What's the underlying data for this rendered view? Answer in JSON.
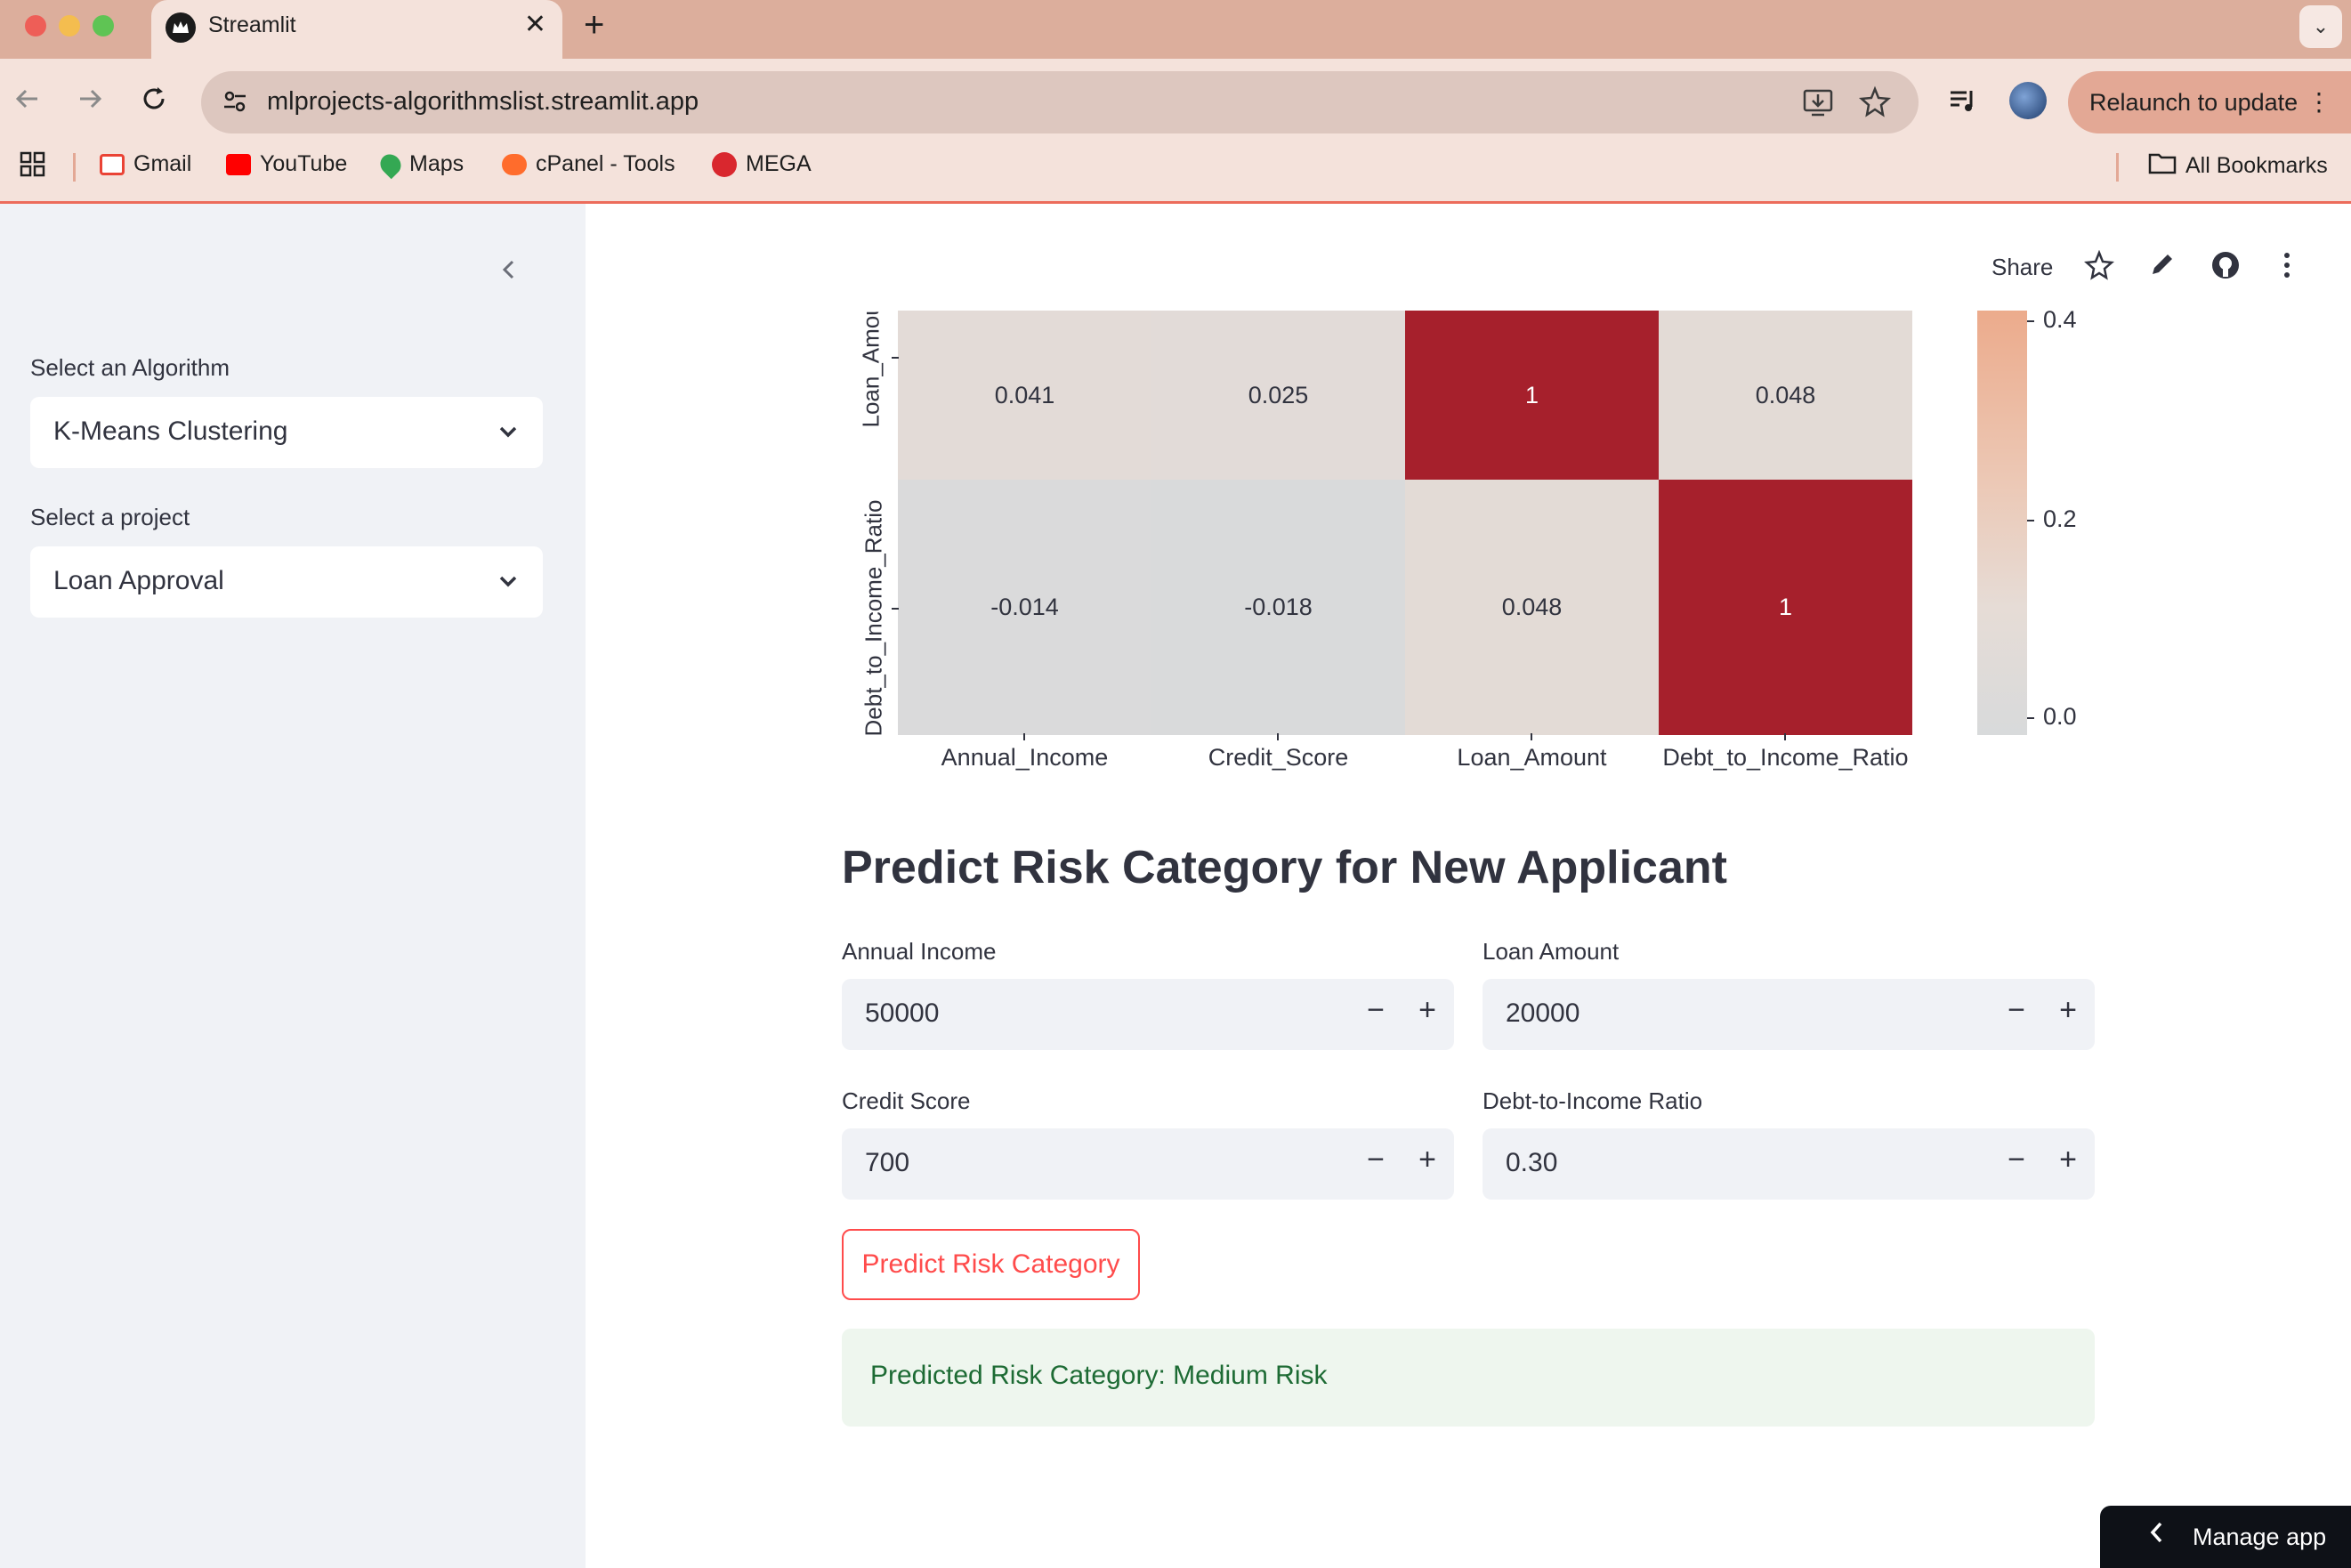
{
  "browser": {
    "tab_title": "Streamlit",
    "tab_close": "✕",
    "new_tab": "+",
    "tab_menu": "⌄",
    "url": "mlprojects-algorithmslist.streamlit.app",
    "relaunch_label": "Relaunch to update",
    "bookmarks": [
      {
        "label": "Gmail",
        "color": "#ea4335"
      },
      {
        "label": "YouTube",
        "color": "#ff0000"
      },
      {
        "label": "Maps",
        "color": "#34a853"
      },
      {
        "label": "cPanel - Tools",
        "color": "#ff6c2c"
      },
      {
        "label": "MEGA",
        "color": "#d9272e"
      }
    ],
    "all_bookmarks": "All Bookmarks"
  },
  "sidebar": {
    "algorithm_label": "Select an Algorithm",
    "algorithm_value": "K-Means Clustering",
    "project_label": "Select a project",
    "project_value": "Loan Approval"
  },
  "header": {
    "share": "Share"
  },
  "chart_data": {
    "type": "heatmap",
    "x_labels": [
      "Annual_Income",
      "Credit_Score",
      "Loan_Amount",
      "Debt_to_Income_Ratio"
    ],
    "y_labels": [
      "Loan_Amount",
      "Debt_to_Income_Ratio"
    ],
    "y_labels_visible": [
      "Loan_Amou",
      "Debt_to_Income_Ratio"
    ],
    "values": [
      [
        "0.041",
        "0.025",
        "1",
        "0.048"
      ],
      [
        "-0.014",
        "-0.018",
        "0.048",
        "1"
      ]
    ],
    "colorbar_ticks": [
      "0.4",
      "0.2",
      "0.0"
    ],
    "colors": {
      "high": "#a6202c",
      "low": "#d8dadb",
      "mid": "#e6dcd6"
    }
  },
  "form": {
    "title": "Predict Risk Category for New Applicant",
    "annual_income_label": "Annual Income",
    "annual_income_value": "50000",
    "loan_amount_label": "Loan Amount",
    "loan_amount_value": "20000",
    "credit_score_label": "Credit Score",
    "credit_score_value": "700",
    "dti_label": "Debt-to-Income Ratio",
    "dti_value": "0.30",
    "minus": "−",
    "plus": "+",
    "predict_button": "Predict Risk Category",
    "result": "Predicted Risk Category: Medium Risk"
  },
  "manage_app": "Manage app"
}
